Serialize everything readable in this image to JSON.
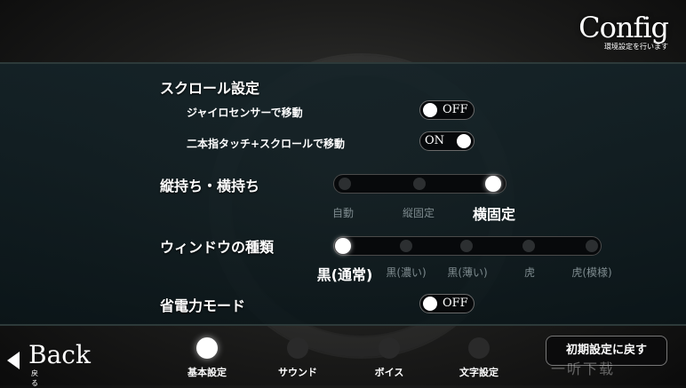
{
  "header": {
    "title": "Config",
    "subtitle": "環境設定を行います"
  },
  "scroll_settings": {
    "heading": "スクロール設定",
    "gyro": {
      "label": "ジャイロセンサーで移動",
      "state": "OFF"
    },
    "two_finger": {
      "label": "二本指タッチ+スクロールで移動",
      "state": "ON"
    }
  },
  "orientation": {
    "heading": "縦持ち・横持ち",
    "options": [
      "自動",
      "縦固定",
      "横固定"
    ],
    "selected": "横固定"
  },
  "window_type": {
    "heading": "ウィンドウの種類",
    "options": [
      "黒(通常)",
      "黒(濃い)",
      "黒(薄い)",
      "虎",
      "虎(模様)"
    ],
    "selected": "黒(通常)"
  },
  "power_saving": {
    "heading": "省電力モード",
    "state": "OFF"
  },
  "footer": {
    "back_label": "Back",
    "back_sub": "戻る",
    "tabs": [
      "基本設定",
      "サウンド",
      "ボイス",
      "文字設定"
    ],
    "active_tab": "基本設定",
    "reset_label": "初期設定に戻す",
    "watermark": "一听下载"
  }
}
